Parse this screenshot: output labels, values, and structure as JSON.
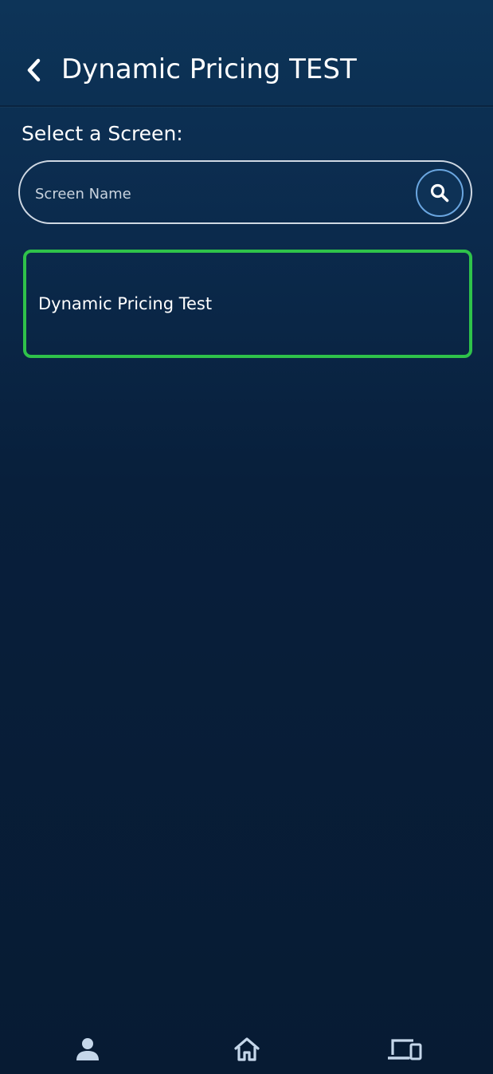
{
  "header": {
    "title": "Dynamic Pricing TEST",
    "back_icon": "chevron-left-icon"
  },
  "section": {
    "label": "Select a Screen:"
  },
  "search": {
    "placeholder": "Screen Name",
    "value": "",
    "icon": "search-icon"
  },
  "screens": [
    {
      "label": "Dynamic Pricing Test",
      "selected": true
    }
  ],
  "bottom_nav": {
    "items": [
      {
        "icon": "person-icon"
      },
      {
        "icon": "home-icon"
      },
      {
        "icon": "devices-icon"
      }
    ]
  },
  "colors": {
    "background_top": "#0d3458",
    "background_bottom": "#071b33",
    "selected_border": "#2fc24a",
    "search_button_border": "#6aa6e0",
    "nav_icon": "#c5d7ea"
  }
}
